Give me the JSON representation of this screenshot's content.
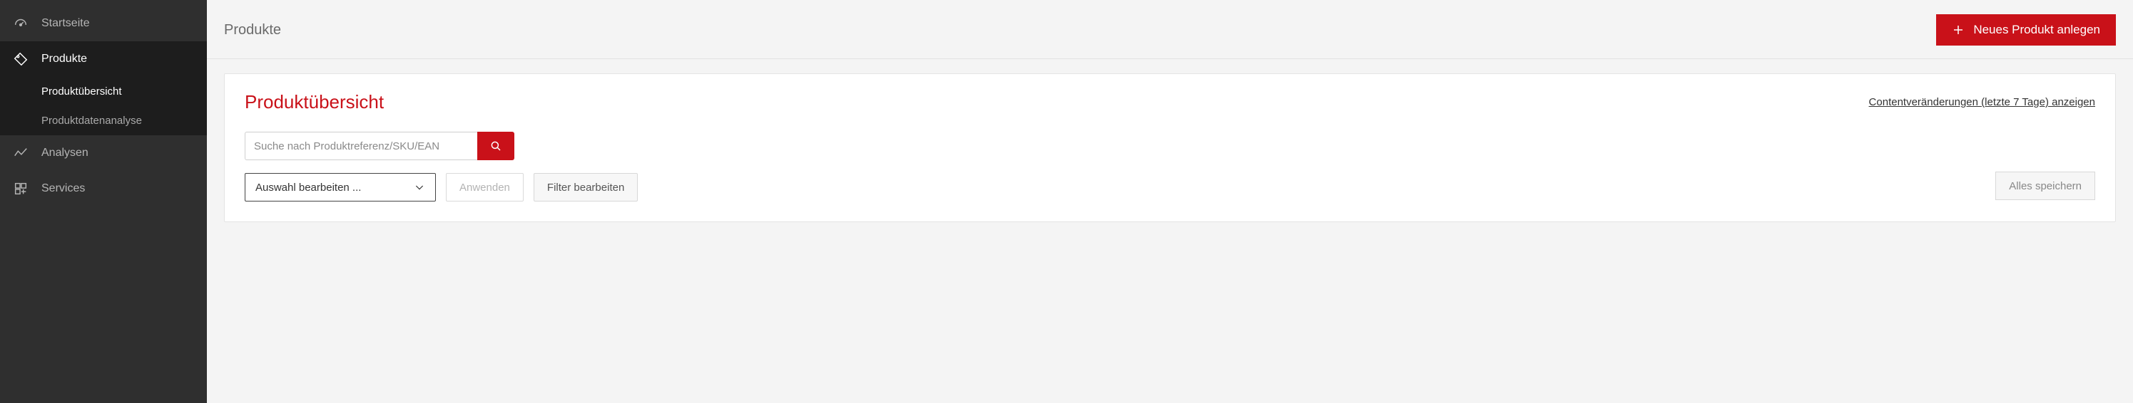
{
  "sidebar": {
    "items": [
      {
        "label": "Startseite",
        "icon": "dashboard-icon"
      },
      {
        "label": "Produkte",
        "icon": "tag-icon"
      },
      {
        "label": "Analysen",
        "icon": "analytics-icon"
      },
      {
        "label": "Services",
        "icon": "services-icon"
      }
    ],
    "sub": [
      {
        "label": "Produktübersicht"
      },
      {
        "label": "Produktdatenanalyse"
      }
    ]
  },
  "header": {
    "title": "Produkte",
    "new_button": "Neues Produkt anlegen"
  },
  "panel": {
    "title": "Produktübersicht",
    "link": "Contentveränderungen (letzte 7 Tage) anzeigen"
  },
  "toolbar": {
    "search_placeholder": "Suche nach Produktreferenz/SKU/EAN",
    "select_label": "Auswahl bearbeiten ...",
    "apply_label": "Anwenden",
    "filter_label": "Filter bearbeiten",
    "save_all_label": "Alles speichern"
  },
  "colors": {
    "accent": "#c91119"
  }
}
